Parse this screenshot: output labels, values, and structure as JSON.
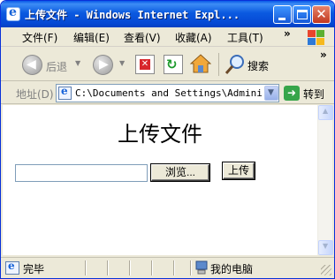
{
  "window": {
    "title": "上传文件 - Windows Internet Expl...",
    "controls": {
      "minimize": "",
      "maximize": "",
      "close": "✕"
    }
  },
  "menubar": {
    "items": [
      "文件(F)",
      "编辑(E)",
      "查看(V)",
      "收藏(A)",
      "工具(T)"
    ],
    "more": "»"
  },
  "toolbar": {
    "back_label": "后退",
    "search_label": "搜索",
    "more": "»"
  },
  "addressbar": {
    "label": "地址(D)",
    "url": "C:\\Documents and Settings\\Administr",
    "go_label": "转到"
  },
  "page": {
    "heading": "上传文件",
    "file_input_value": "",
    "browse_label": "浏览...",
    "upload_label": "上传"
  },
  "statusbar": {
    "status": "完毕",
    "zone": "我的电脑"
  },
  "colors": {
    "titlebar": "#0548d4",
    "chrome": "#ece9d8",
    "go_green": "#36a54a",
    "stop_red": "#d8262c"
  }
}
